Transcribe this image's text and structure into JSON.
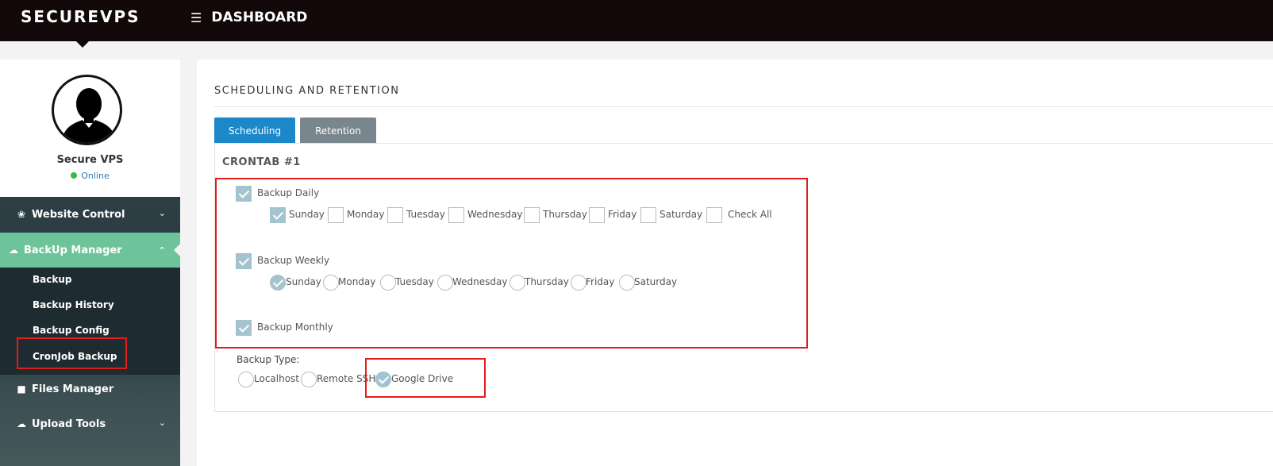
{
  "app": {
    "brand": "SECUREVPS",
    "menu_label": "DASHBOARD"
  },
  "profile": {
    "name": "Secure VPS",
    "status": "Online"
  },
  "sidebar": {
    "items": [
      {
        "label": "Website Control",
        "icon": "dashboard-icon"
      },
      {
        "label": "BackUp Manager",
        "icon": "cloud-download-icon",
        "active": true
      },
      {
        "label": "Files Manager",
        "icon": "folder-icon"
      },
      {
        "label": "Upload Tools",
        "icon": "cloud-upload-icon"
      }
    ],
    "backup_sub": [
      "Backup",
      "Backup History",
      "Backup Config",
      "CronJob Backup"
    ]
  },
  "main": {
    "section_title": "SCHEDULING AND RETENTION",
    "tabs": [
      {
        "label": "Scheduling",
        "active": true
      },
      {
        "label": "Retention",
        "active": false
      }
    ],
    "crontab_title": "CRONTAB #1",
    "daily": {
      "label": "Backup Daily",
      "checked": true,
      "days": [
        {
          "label": "Sunday",
          "checked": true
        },
        {
          "label": "Monday",
          "checked": false
        },
        {
          "label": "Tuesday",
          "checked": false
        },
        {
          "label": "Wednesday",
          "checked": false
        },
        {
          "label": "Thursday",
          "checked": false
        },
        {
          "label": "Friday",
          "checked": false
        },
        {
          "label": "Saturday",
          "checked": false
        },
        {
          "label": "Check All",
          "checked": false
        }
      ]
    },
    "weekly": {
      "label": "Backup Weekly",
      "checked": true,
      "days": [
        {
          "label": "Sunday",
          "selected": true
        },
        {
          "label": "Monday",
          "selected": false
        },
        {
          "label": "Tuesday",
          "selected": false
        },
        {
          "label": "Wednesday",
          "selected": false
        },
        {
          "label": "Thursday",
          "selected": false
        },
        {
          "label": "Friday",
          "selected": false
        },
        {
          "label": "Saturday",
          "selected": false
        }
      ]
    },
    "monthly": {
      "label": "Backup Monthly",
      "checked": true
    },
    "backup_type": {
      "label": "Backup Type:",
      "options": [
        {
          "label": "Localhost",
          "selected": false
        },
        {
          "label": "Remote SSH",
          "selected": false
        },
        {
          "label": "Google Drive",
          "selected": true
        }
      ]
    }
  },
  "colors": {
    "topbar": "#130809",
    "active_nav": "#6dc49b",
    "tab_active": "#1c87c9",
    "tab_inactive": "#7a868e",
    "check_fill": "#a3c4cf",
    "highlight": "#e41b1b"
  }
}
